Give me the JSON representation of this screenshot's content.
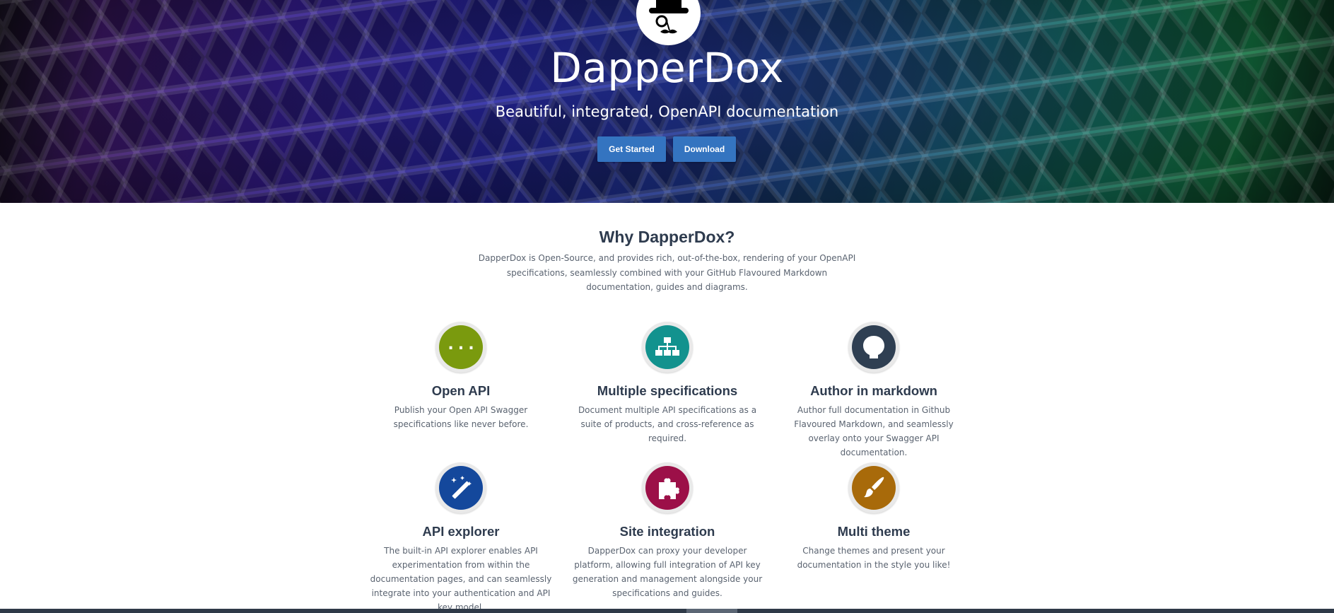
{
  "hero": {
    "title": "DapperDox",
    "subtitle": "Beautiful, integrated, OpenAPI documentation",
    "buttons": {
      "get_started": "Get Started",
      "download": "Download"
    },
    "logo_icon": "dapper-mascot-icon",
    "button_color": "#3474c0"
  },
  "why": {
    "title": "Why DapperDox?",
    "intro": "DapperDox is Open-Source, and provides rich, out-of-the-box, rendering of your OpenAPI specifications, seamlessly combined with your GitHub Flavoured Markdown documentation, guides and diagrams."
  },
  "features": [
    {
      "title": "Open API",
      "text": "Publish your Open API Swagger specifications like never before.",
      "icon": "curly-braces-icon",
      "color": "#7a9a0e"
    },
    {
      "title": "Multiple specifications",
      "text": "Document multiple API specifications as a suite of products, and cross-reference as required.",
      "icon": "sitemap-icon",
      "color": "#12928e"
    },
    {
      "title": "Author in markdown",
      "text": "Author full documentation in Github Flavoured Markdown, and seamlessly overlay onto your Swagger API documentation.",
      "icon": "github-icon",
      "color": "#2f3f52"
    },
    {
      "title": "API explorer",
      "text": "The built-in API explorer enables API experimentation from within the documentation pages, and can seamlessly integrate into your authentication and API key model.",
      "icon": "magic-wand-icon",
      "color": "#14489c"
    },
    {
      "title": "Site integration",
      "text": "DapperDox can proxy your developer platform, allowing full integration of API key generation and management alongside your specifications and guides.",
      "icon": "puzzle-piece-icon",
      "color": "#9c1048"
    },
    {
      "title": "Multi theme",
      "text": "Change themes and present your documentation in the style you like!",
      "icon": "paintbrush-icon",
      "color": "#a86a0a"
    }
  ]
}
